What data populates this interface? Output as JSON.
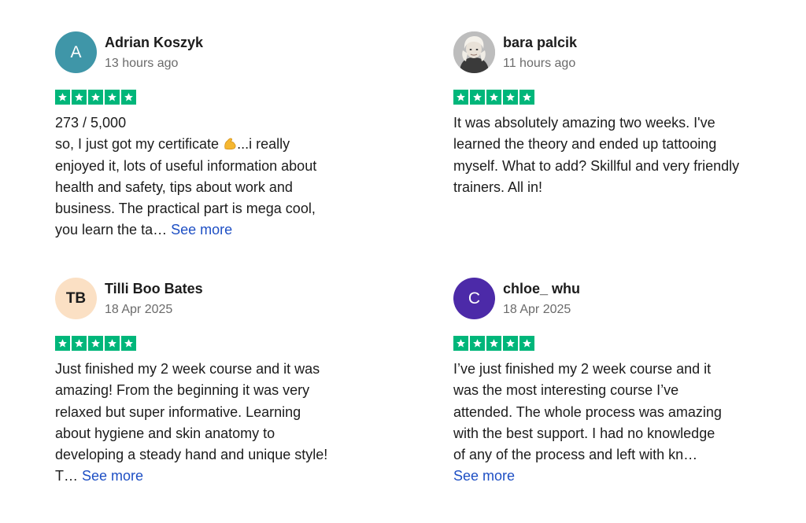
{
  "reviews": [
    {
      "initials": "A",
      "name": "Adrian Koszyk",
      "date": "13 hours ago",
      "rating": 5,
      "counter": "273 / 5,000",
      "text_before_emoji": "so, I just got my certificate ",
      "emoji": "flexed-biceps-emoji",
      "text_after_emoji": "...i really\nenjoyed it, lots of useful information about\nhealth and safety, tips about work and\nbusiness. The practical part is mega cool,\nyou learn the ta… ",
      "see_more": "See more"
    },
    {
      "avatar": "profile-photo",
      "name": "bara palcik",
      "date": "11 hours ago",
      "rating": 5,
      "text": "It was absolutely amazing two weeks. I've\nlearned the theory and ended up tattooing\nmyself. What to add? Skillful and very friendly\ntrainers. All in!"
    },
    {
      "initials": "TB",
      "name": "Tilli Boo Bates",
      "date": "18 Apr 2025",
      "rating": 5,
      "text": "Just finished my 2 week course and it was\namazing! From the beginning it was very\nrelaxed but super informative. Learning\nabout hygiene and skin anatomy to\ndeveloping a steady hand and unique style!\nT… ",
      "see_more": "See more"
    },
    {
      "initials": "C",
      "name": "chloe_ whu",
      "date": "18 Apr 2025",
      "rating": 5,
      "text": "I’ve just finished my 2 week course and it\nwas the most interesting course I’ve\nattended. The whole process was amazing\nwith the best support. I had no knowledge\nof any of the process and left with kn…\n",
      "see_more": "See more"
    }
  ],
  "colors": {
    "star_green": "#00b67a",
    "link_blue": "#1e4fc4",
    "avatar_a": "#3f96a8",
    "avatar_tb": "#fbe0c4",
    "avatar_c": "#4c2aa8"
  }
}
